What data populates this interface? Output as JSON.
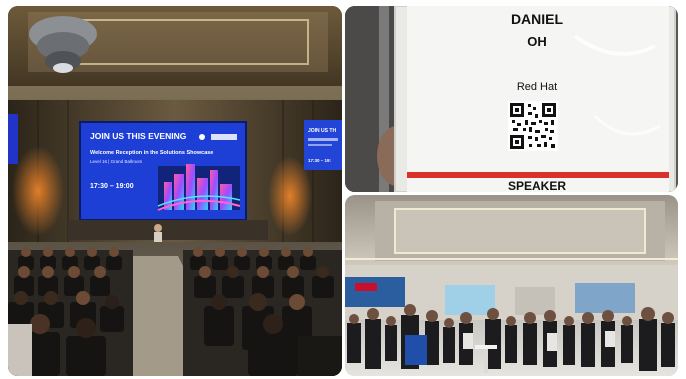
{
  "conference_hall": {
    "screen_main": {
      "heading": "JOIN US THIS EVENING",
      "event_title": "Welcome Reception in the Solutions Showcase",
      "location": "Level 16 | Grand Ballroom",
      "time": "17:30 – 19:00"
    },
    "screen_side": {
      "heading": "JOIN US TH",
      "time": "17:30 – 19:"
    }
  },
  "name_badge": {
    "first_name": "DANIEL",
    "last_name": "OH",
    "company": "Red Hat",
    "role": "SPEAKER"
  },
  "colors": {
    "screen_blue": "#1d3fd6",
    "speaker_bar": "#d9322a",
    "badge_white": "#f5f5f3"
  }
}
